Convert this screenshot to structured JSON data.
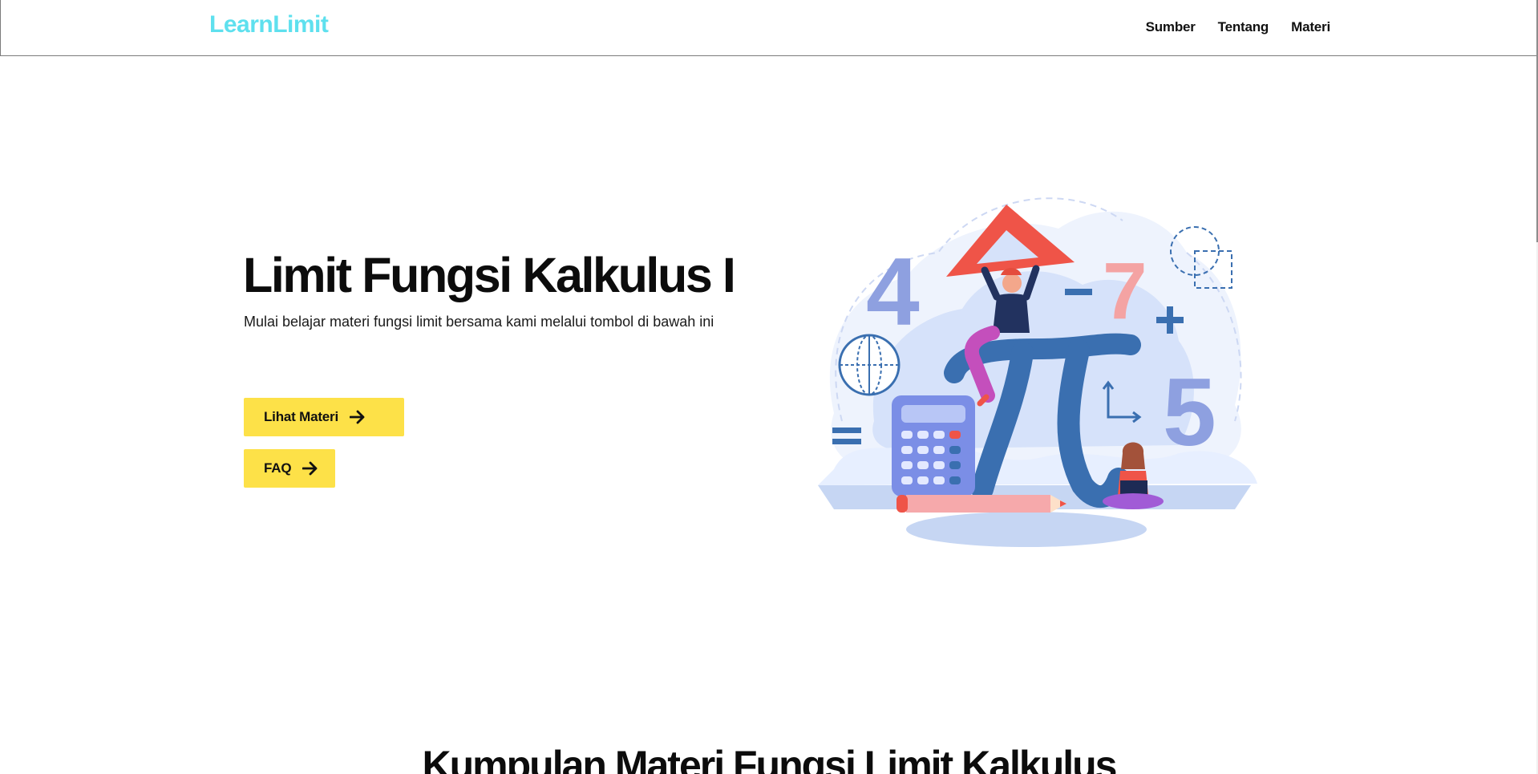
{
  "navbar": {
    "brand": "LearnLimit",
    "links": [
      "Sumber",
      "Tentang",
      "Materi"
    ]
  },
  "hero": {
    "title": "Limit Fungsi Kalkulus I",
    "subtitle": "Mulai belajar materi fungsi limit bersama kami melalui tombol di bawah ini",
    "buttons": [
      {
        "label": "Lihat Materi",
        "icon": "arrow-right-icon"
      },
      {
        "label": "FAQ",
        "icon": "arrow-right-icon"
      }
    ],
    "illustration": {
      "numbers": [
        "4",
        "7",
        "5"
      ],
      "symbols": [
        "-",
        "+",
        "=",
        "π"
      ]
    }
  },
  "section": {
    "title": "Kumpulan Materi Fungsi Limit Kalkulus"
  },
  "colors": {
    "brand": "#5ee0ee",
    "button": "#fde148",
    "text": "#111111",
    "illustration_blue": "#3a6fb0",
    "illustration_red": "#ef5448",
    "illustration_lavender": "#8ea0e0"
  }
}
